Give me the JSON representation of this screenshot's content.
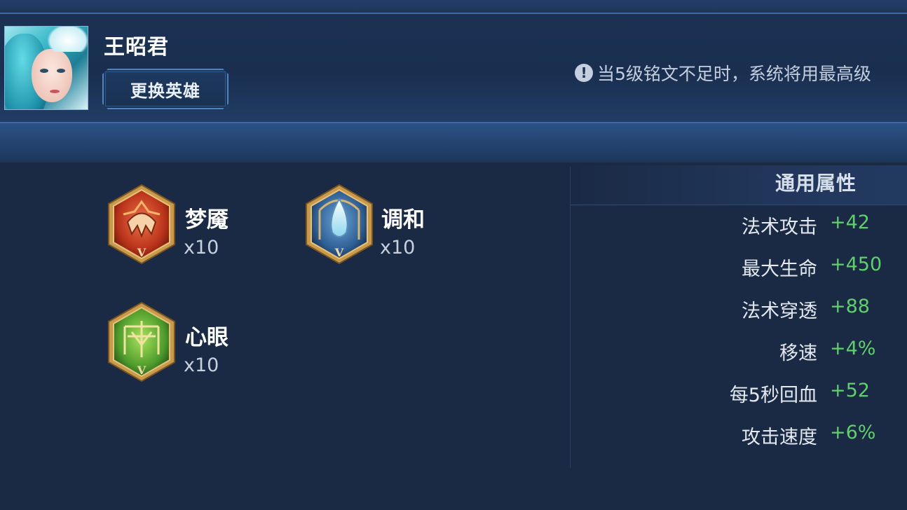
{
  "hero": {
    "name": "王昭君",
    "change_button": "更换英雄"
  },
  "notice": {
    "icon": "exclamation-icon",
    "text": "当5级铭文不足时，系统将用最高级"
  },
  "runes": [
    {
      "name": "梦魇",
      "count": "x10",
      "icon": "red-rune-icon",
      "level": "V",
      "color": "#c2401e"
    },
    {
      "name": "调和",
      "count": "x10",
      "icon": "blue-rune-icon",
      "level": "V",
      "color": "#3e6fa6"
    },
    {
      "name": "心眼",
      "count": "x10",
      "icon": "green-rune-icon",
      "level": "V",
      "color": "#5aa53a"
    }
  ],
  "stats": {
    "title": "通用属性",
    "items": [
      {
        "label": "法术攻击",
        "value": "+42"
      },
      {
        "label": "最大生命",
        "value": "+450"
      },
      {
        "label": "法术穿透",
        "value": "+88"
      },
      {
        "label": "移速",
        "value": "+4%"
      },
      {
        "label": "每5秒回血",
        "value": "+52"
      },
      {
        "label": "攻击速度",
        "value": "+6%"
      }
    ]
  },
  "colors": {
    "background": "#1a2a45",
    "stat_value": "#5fd06a",
    "accent_border": "#4f82be"
  }
}
